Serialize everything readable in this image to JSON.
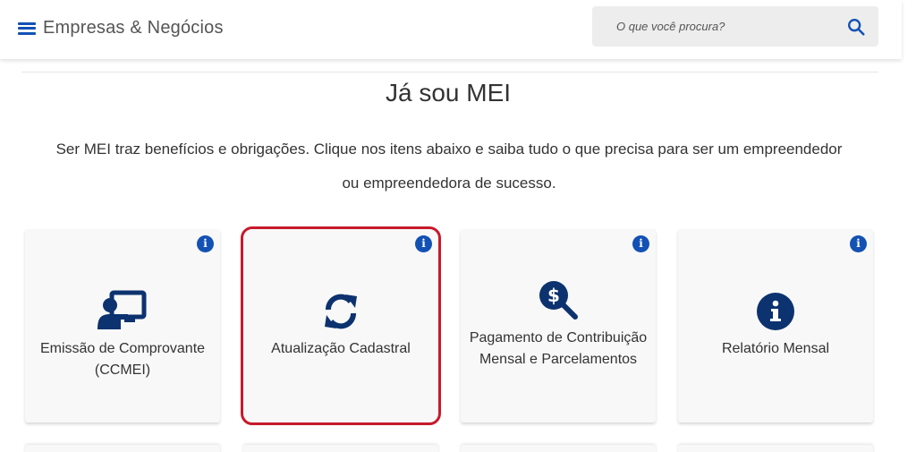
{
  "header": {
    "site_title": "Empresas & Negócios",
    "search_placeholder": "O que você procura?"
  },
  "main": {
    "title": "Já sou MEI",
    "lead": "Ser MEI traz benefícios e obrigações. Clique nos itens abaixo e saiba tudo o que precisa para ser um empreendedor ou empreendedora de sucesso.",
    "cards": [
      {
        "label": "Emissão de Comprovante (CCMEI)",
        "icon": "presentation-user-icon",
        "info": "i"
      },
      {
        "label": "Atualização Cadastral",
        "icon": "refresh-icon",
        "info": "i",
        "highlighted": true
      },
      {
        "label": "Pagamento de Contribuição Mensal e Parcelamentos",
        "icon": "dollar-magnifier-icon",
        "info": "i"
      },
      {
        "label": "Relatório Mensal",
        "icon": "info-circle-icon",
        "info": "i"
      }
    ]
  },
  "colors": {
    "primary_blue": "#1351b4",
    "icon_navy": "#0c326f",
    "highlight_red": "#c8192b"
  }
}
